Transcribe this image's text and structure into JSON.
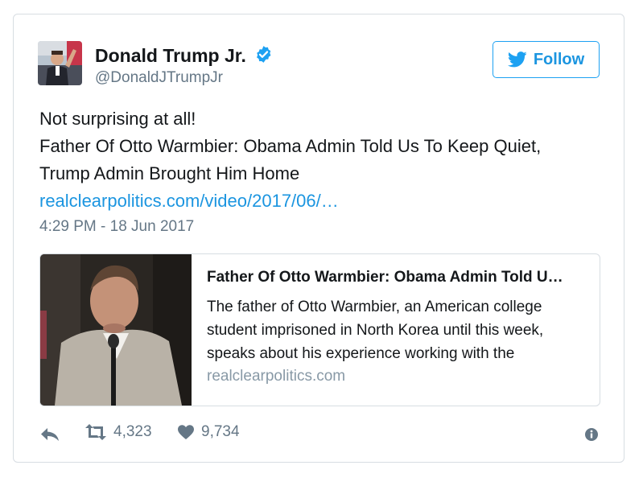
{
  "author": {
    "name": "Donald Trump Jr.",
    "handle": "@DonaldJTrumpJr",
    "verified": true
  },
  "follow_button": {
    "label": "Follow",
    "icon": "twitter-bird-icon"
  },
  "tweet": {
    "lines": [
      "Not surprising at all!",
      "Father Of Otto Warmbier: Obama Admin Told Us To Keep Quiet,",
      "Trump Admin Brought Him Home"
    ],
    "link_text": "realclearpolitics.com/video/2017/06/…",
    "timestamp": "4:29 PM - 18 Jun 2017"
  },
  "link_card": {
    "title": "Father Of Otto Warmbier: Obama Admin Told U…",
    "description": "The father of Otto Warmbier, an American college student imprisoned in North Korea until this week, speaks about his experience working with the",
    "domain": "realclearpolitics.com"
  },
  "actions": {
    "reply_icon": "reply-icon",
    "retweet_icon": "retweet-icon",
    "retweet_count": "4,323",
    "like_icon": "heart-icon",
    "like_count": "9,734",
    "info_icon": "info-icon"
  },
  "colors": {
    "link": "#1b95e0",
    "follow_border": "#1da1f2",
    "verified": "#1da1f2",
    "muted_text": "#657786",
    "icon_gray": "#657786",
    "border": "#d7dde2"
  }
}
